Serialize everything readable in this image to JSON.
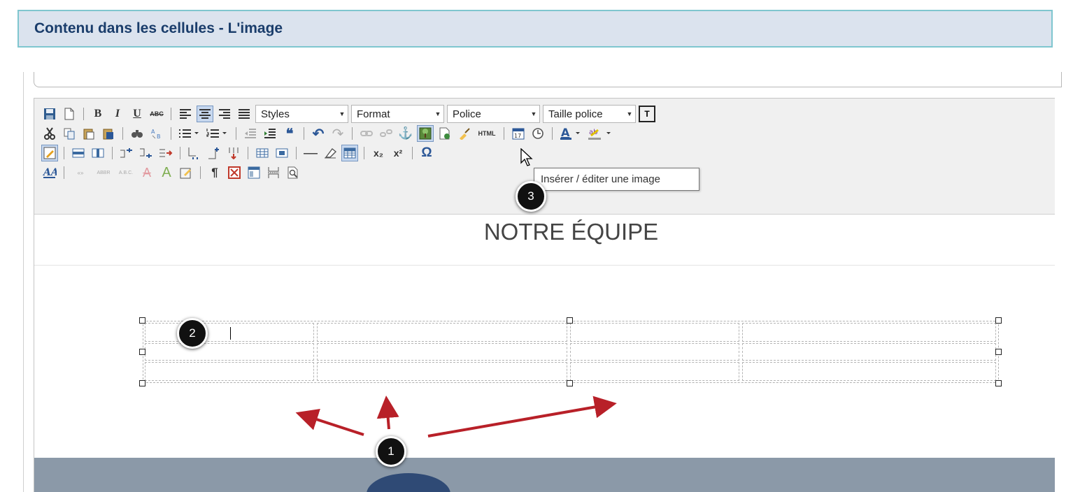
{
  "header": {
    "title": "Contenu dans les cellules - L'image"
  },
  "toolbar": {
    "combos": {
      "styles": "Styles",
      "format": "Format",
      "police": "Police",
      "taille": "Taille police"
    },
    "text_button": "T",
    "icons": [
      "save-icon",
      "new-page-icon",
      "bold-icon",
      "italic-icon",
      "underline-icon",
      "strikethrough-icon",
      "align-left-icon",
      "align-center-icon",
      "align-right-icon",
      "justify-icon",
      "cut-icon",
      "copy-icon",
      "paste-icon",
      "paste-word-icon",
      "find-icon",
      "replace-icon",
      "bulleted-list-icon",
      "numbered-list-icon",
      "outdent-icon",
      "indent-icon",
      "blockquote-icon",
      "undo-icon",
      "redo-icon",
      "link-icon",
      "unlink-icon",
      "anchor-icon",
      "image-icon",
      "flash-icon",
      "clean-icon",
      "html-icon",
      "date-icon",
      "time-icon",
      "text-color-icon",
      "highlight-color-icon",
      "show-blocks-icon",
      "table-row-icon",
      "table-col-icon",
      "insert-row-icon",
      "delete-row-icon",
      "horizontal-rule-icon",
      "eraser-icon",
      "table-icon",
      "subscript-icon",
      "superscript-icon",
      "special-char-icon",
      "typography-icon",
      "quotes-icon",
      "font-size-icon",
      "paragraph-icon",
      "page-break-icon",
      "preview-icon"
    ],
    "glyphs": {
      "bold": "B",
      "italic": "I",
      "underline": "U",
      "strike": "ABC",
      "quote": "❝",
      "undo": "↶",
      "redo": "↷",
      "anchor": "⚓",
      "html": "HTML",
      "color_a": "A",
      "omega": "Ω",
      "sub": "x₂",
      "sup": "x²",
      "pilcrow": "¶",
      "type_a": "A",
      "hr": "—"
    },
    "tooltip": "Insérer / éditer une image"
  },
  "document": {
    "title": "NOTRE ÉQUIPE"
  },
  "callouts": [
    {
      "label": "1"
    },
    {
      "label": "2"
    },
    {
      "label": "3"
    }
  ],
  "colors": {
    "header_bg": "#dbe3ee",
    "header_border": "#7fc6cf",
    "arrow": "#b82028",
    "active_btn": "#c7d8ef"
  }
}
